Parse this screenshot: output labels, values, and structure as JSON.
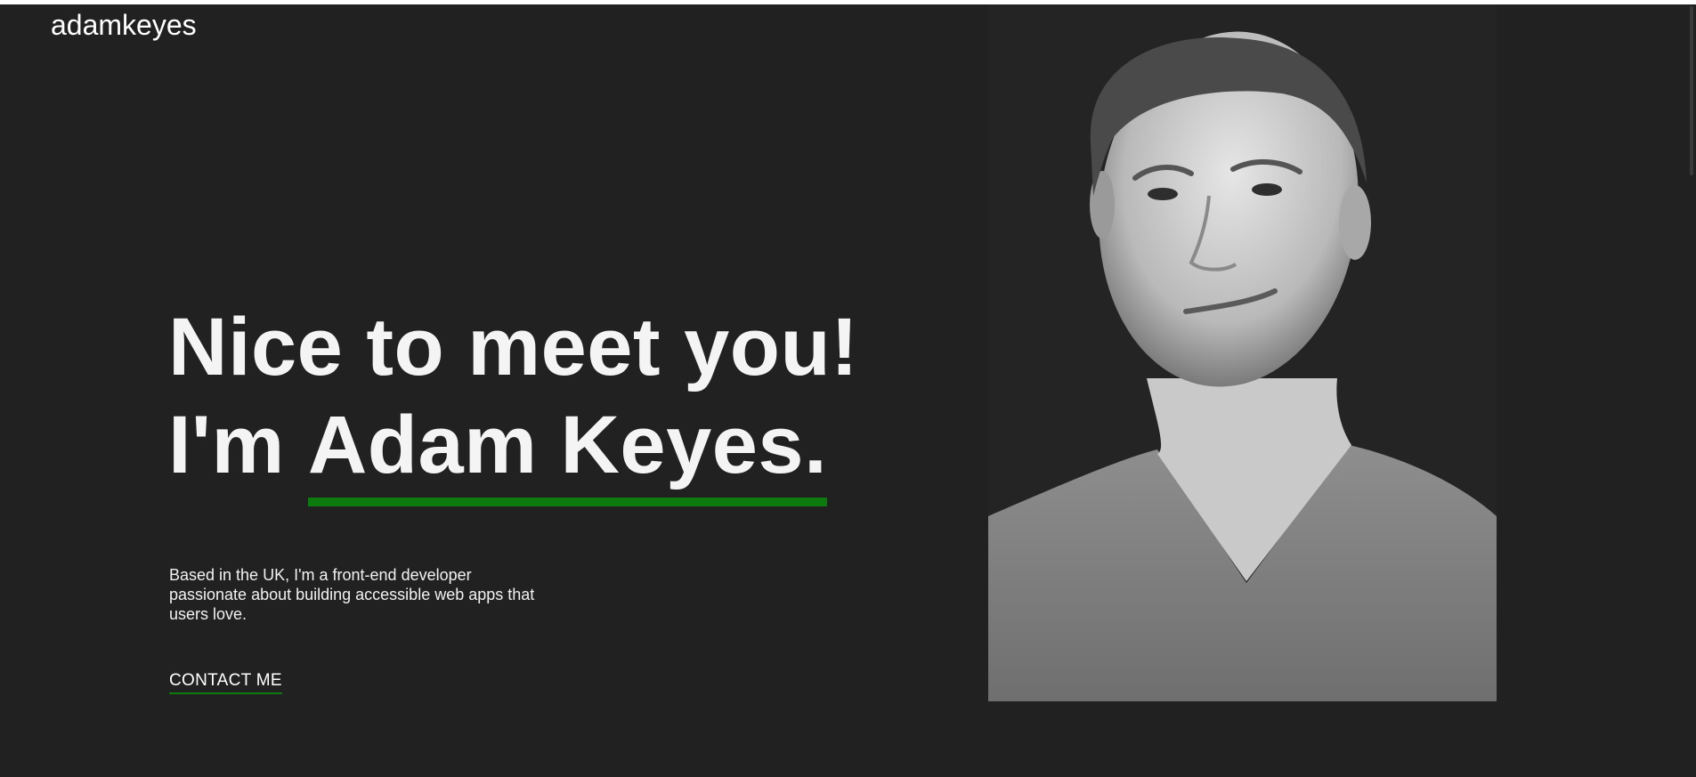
{
  "header": {
    "brand": "adamkeyes",
    "socials": [
      {
        "name": "github-icon"
      },
      {
        "name": "codewars-icon"
      },
      {
        "name": "linkedin-icon"
      },
      {
        "name": "twitter-icon"
      }
    ]
  },
  "hero": {
    "line1": "Nice to meet you!",
    "line2_prefix": "I'm ",
    "name": "Adam Keyes.",
    "intro": "Based in the UK, I'm a front-end developer passionate about building accessible web apps that users love.",
    "cta_label": "CONTACT ME"
  },
  "colors": {
    "background": "#212121",
    "text": "#ffffff",
    "accent": "#0c7a0c"
  }
}
